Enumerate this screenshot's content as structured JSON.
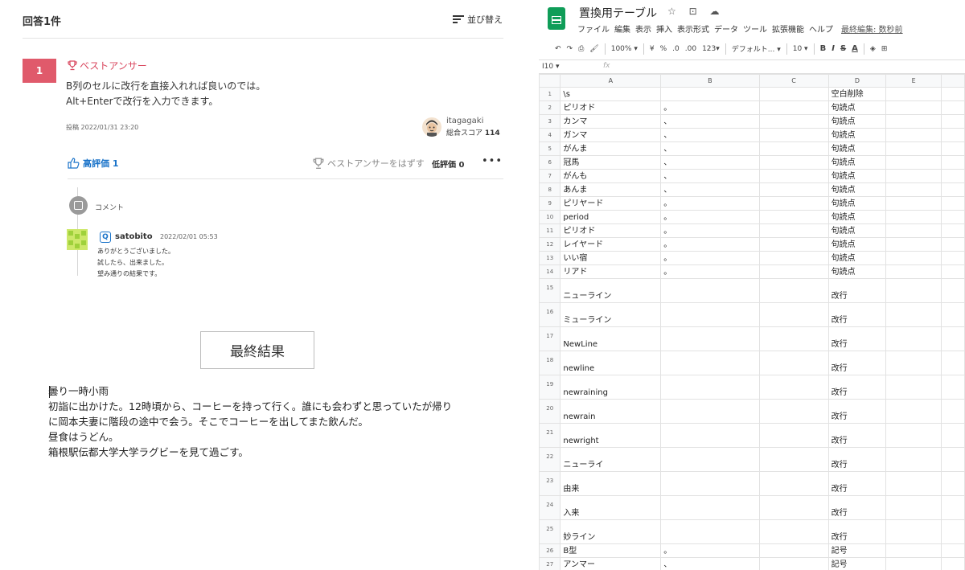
{
  "qa": {
    "answer_count": "回答1件",
    "sort_label": "並び替え",
    "rank": "1",
    "best_label": "ベストアンサー",
    "body_lines": "B列のセルに改行を直接入れれば良いのでは。\nAlt+Enterで改行を入力できます。",
    "posted": "投稿 2022/01/31 23:20",
    "author": "itagagaki",
    "score_label": "総合スコア",
    "score_value": "114",
    "like_label": "高評価 1",
    "unbest_label": "ベストアンサーをはずす",
    "dislike_label": "低評価 0",
    "more_label": "•••",
    "comment_label": "コメント",
    "comment": {
      "badge": "Q",
      "user": "satobito",
      "date": "2022/02/01 05:53",
      "text": "ありがとうございました。\n試したら、出来ました。\n望み通りの結果です。"
    }
  },
  "result_title": "最終結果",
  "diary": "曇り一時小雨\n初詣に出かけた。12時頃から、コーヒーを持って行く。誰にも会わずと思っていたが帰り\nに岡本夫妻に階段の途中で会う。そこでコーヒーを出してまた飲んだ。\n昼食はうどん。\n箱根駅伝都大学大学ラグビーを見て過ごす。",
  "sheet": {
    "title": "置換用テーブル",
    "title_icons": "☆ ⊡ ☁",
    "menu": [
      "ファイル",
      "編集",
      "表示",
      "挿入",
      "表示形式",
      "データ",
      "ツール",
      "拡張機能",
      "ヘルプ"
    ],
    "last_edit": "最終編集: 数秒前",
    "toolbar": {
      "undo": "↶",
      "redo": "↷",
      "print": "⎙",
      "paint": "🖌",
      "zoom": "100% ▾",
      "currency": "¥",
      "percent": "%",
      "dec_less": ".0",
      "dec_more": ".00",
      "format": "123▾",
      "font": "デフォルト... ▾",
      "size": "10 ▾",
      "bold": "B",
      "italic": "I",
      "strike": "S",
      "color": "A",
      "fill": "◈",
      "border": "⊞"
    },
    "name_box": "I10 ▾",
    "fx": "fx",
    "columns": [
      "A",
      "B",
      "C",
      "D",
      "E"
    ],
    "rows": [
      {
        "n": "1",
        "a": "\\s",
        "b": "",
        "d": "空白削除"
      },
      {
        "n": "2",
        "a": "ピリオド",
        "b": "。",
        "d": "句読点"
      },
      {
        "n": "3",
        "a": "カンマ",
        "b": "、",
        "d": "句読点"
      },
      {
        "n": "4",
        "a": "ガンマ",
        "b": "、",
        "d": "句読点"
      },
      {
        "n": "5",
        "a": "がんま",
        "b": "、",
        "d": "句読点"
      },
      {
        "n": "6",
        "a": "冠馬",
        "b": "、",
        "d": "句読点"
      },
      {
        "n": "7",
        "a": "がんも",
        "b": "、",
        "d": "句読点"
      },
      {
        "n": "8",
        "a": "あんま",
        "b": "、",
        "d": "句読点"
      },
      {
        "n": "9",
        "a": "ピリヤード",
        "b": "。",
        "d": "句読点"
      },
      {
        "n": "10",
        "a": "period",
        "b": "。",
        "d": "句読点"
      },
      {
        "n": "11",
        "a": "ピリオド",
        "b": "。",
        "d": "句読点"
      },
      {
        "n": "12",
        "a": "レイヤード",
        "b": "。",
        "d": "句読点"
      },
      {
        "n": "13",
        "a": "いい宿",
        "b": "。",
        "d": "句読点"
      },
      {
        "n": "14",
        "a": "リアド",
        "b": "。",
        "d": "句読点"
      },
      {
        "n": "15",
        "a": "ニューライン",
        "b": "",
        "d": "改行"
      },
      {
        "n": "16",
        "a": "ミューライン",
        "b": "",
        "d": "改行"
      },
      {
        "n": "17",
        "a": "NewLine",
        "b": "",
        "d": "改行"
      },
      {
        "n": "18",
        "a": "newline",
        "b": "",
        "d": "改行"
      },
      {
        "n": "19",
        "a": "newraining",
        "b": "",
        "d": "改行"
      },
      {
        "n": "20",
        "a": "newrain",
        "b": "",
        "d": "改行"
      },
      {
        "n": "21",
        "a": "newright",
        "b": "",
        "d": "改行"
      },
      {
        "n": "22",
        "a": "ニューライ",
        "b": "",
        "d": "改行"
      },
      {
        "n": "23",
        "a": "由来",
        "b": "",
        "d": "改行"
      },
      {
        "n": "24",
        "a": "入来",
        "b": "",
        "d": "改行"
      },
      {
        "n": "25",
        "a": "妙ライン",
        "b": "",
        "d": "改行"
      },
      {
        "n": "26",
        "a": "B型",
        "b": "。",
        "d": "記号"
      },
      {
        "n": "27",
        "a": "アンマー",
        "b": "、",
        "d": "記号"
      }
    ]
  }
}
